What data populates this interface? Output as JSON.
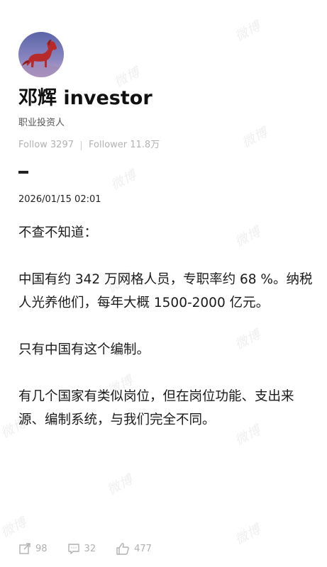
{
  "profile": {
    "name": "邓辉 investor",
    "bio": "职业投资人",
    "follow_label": "Follow 3297",
    "follower_label": "Follower 11.8万"
  },
  "post": {
    "timestamp": "2026/01/15 02:01",
    "paragraphs": [
      "不查不知道：",
      "",
      "中国有约 342 万网格人员，专职率约 68 %。纳税人光养他们，每年大概 1500-2000 亿元。",
      "",
      "只有中国有这个编制。",
      "",
      "有几个国家有类似岗位，但在岗位功能、支出来源、编制系统，与我们完全不同。"
    ]
  },
  "actions": {
    "repost_count": "98",
    "comment_count": "32",
    "like_count": "477"
  },
  "watermark": {
    "text": "微博"
  },
  "icons": {
    "repost": "repost-icon",
    "comment": "comment-icon",
    "like": "like-icon",
    "avatar": "horse-avatar"
  },
  "colors": {
    "text": "#111111",
    "muted": "#b2b2b2",
    "avatar_bg": "#6a74b3",
    "horse": "#b82a2a"
  }
}
